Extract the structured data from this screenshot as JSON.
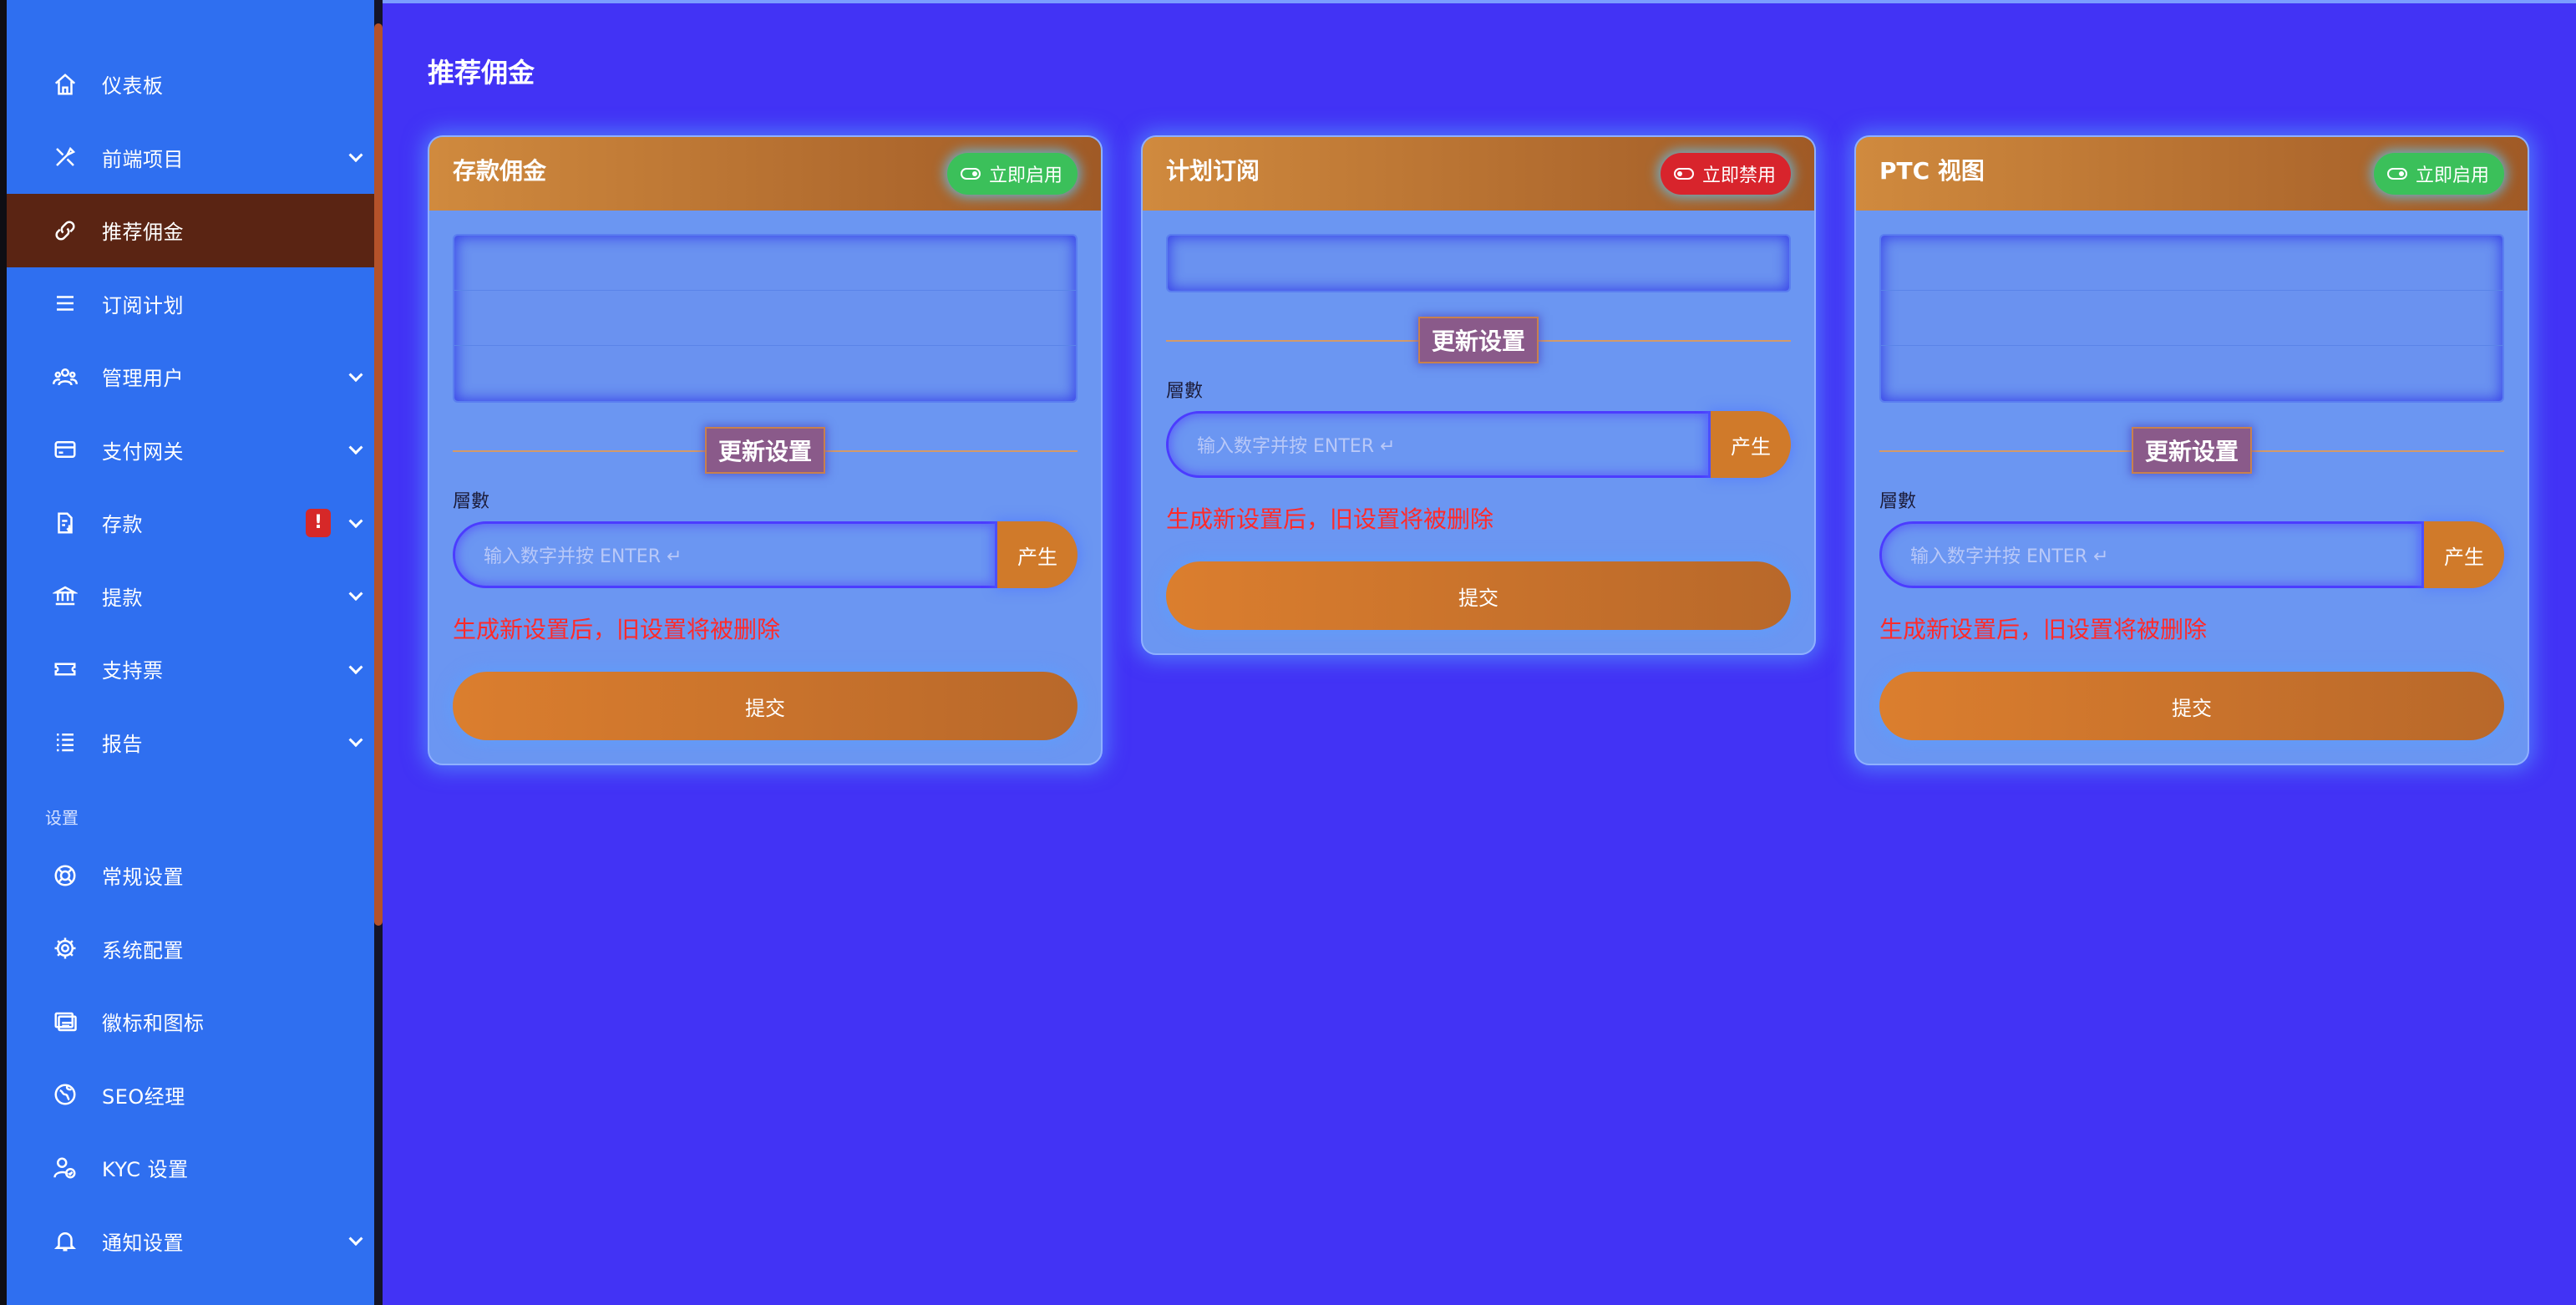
{
  "sidebar": {
    "items": [
      {
        "label": "仪表板",
        "icon": "home-icon",
        "has_chevron": false,
        "active": false
      },
      {
        "label": "前端项目",
        "icon": "tools-icon",
        "has_chevron": true,
        "active": false
      },
      {
        "label": "推荐佣金",
        "icon": "link-icon",
        "has_chevron": false,
        "active": true
      },
      {
        "label": "订阅计划",
        "icon": "list-icon",
        "has_chevron": false,
        "active": false
      },
      {
        "label": "管理用户",
        "icon": "users-icon",
        "has_chevron": true,
        "active": false
      },
      {
        "label": "支付网关",
        "icon": "credit-card-icon",
        "has_chevron": true,
        "active": false
      },
      {
        "label": "存款",
        "icon": "deposit-icon",
        "has_chevron": true,
        "active": false,
        "badge": "!"
      },
      {
        "label": "提款",
        "icon": "bank-icon",
        "has_chevron": true,
        "active": false
      },
      {
        "label": "支持票",
        "icon": "ticket-icon",
        "has_chevron": true,
        "active": false
      },
      {
        "label": "报告",
        "icon": "report-icon",
        "has_chevron": true,
        "active": false
      }
    ],
    "section_label": "设置",
    "settings_items": [
      {
        "label": "常规设置",
        "icon": "lifebuoy-icon",
        "has_chevron": false
      },
      {
        "label": "系统配置",
        "icon": "gear-icon",
        "has_chevron": false
      },
      {
        "label": "徽标和图标",
        "icon": "images-icon",
        "has_chevron": false
      },
      {
        "label": "SEO经理",
        "icon": "globe-icon",
        "has_chevron": false
      },
      {
        "label": "KYC 设置",
        "icon": "kyc-icon",
        "has_chevron": false
      },
      {
        "label": "通知设置",
        "icon": "bell-icon",
        "has_chevron": true
      }
    ]
  },
  "main": {
    "page_title": "推荐佣金",
    "cards": [
      {
        "title": "存款佣金",
        "toggle_label": "立即启用",
        "toggle_state": "enabled",
        "level_rows": 3,
        "divider_label": "更新设置",
        "field_label": "層數",
        "input_placeholder": "输入数字并按 ENTER ↵",
        "generate_label": "产生",
        "warning": "生成新设置后，旧设置将被删除",
        "submit_label": "提交"
      },
      {
        "title": "计划订阅",
        "toggle_label": "立即禁用",
        "toggle_state": "disabled",
        "level_rows": 1,
        "divider_label": "更新设置",
        "field_label": "層數",
        "input_placeholder": "输入数字并按 ENTER ↵",
        "generate_label": "产生",
        "warning": "生成新设置后，旧设置将被删除",
        "submit_label": "提交"
      },
      {
        "title": "PTC 视图",
        "toggle_label": "立即启用",
        "toggle_state": "enabled",
        "level_rows": 3,
        "divider_label": "更新设置",
        "field_label": "層數",
        "input_placeholder": "输入数字并按 ENTER ↵",
        "generate_label": "产生",
        "warning": "生成新设置后，旧设置将被删除",
        "submit_label": "提交"
      }
    ]
  },
  "colors": {
    "main_bg": "#4233f5",
    "sidebar_bg": "#2f6ff0",
    "active_item_bg": "#5a2413",
    "card_bg": "#6b96f2",
    "accent_orange": "#d07a2a",
    "enable_green": "#3bc05a",
    "disable_red": "#d8242c",
    "warning_red": "#ff2a2a"
  }
}
